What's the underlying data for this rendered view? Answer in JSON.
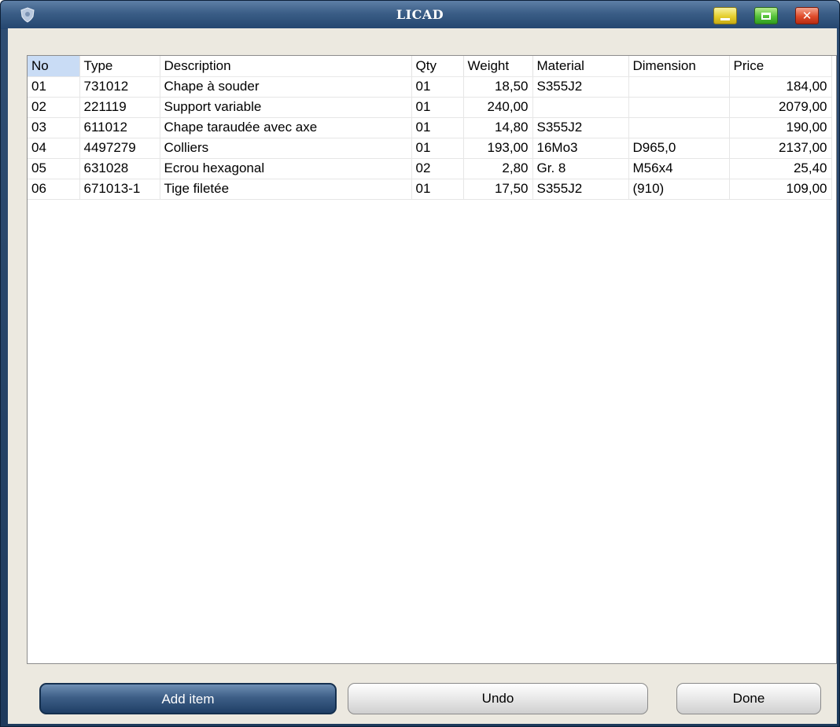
{
  "window": {
    "title": "LICAD",
    "app_icon": "shield-crest-icon"
  },
  "title_buttons": {
    "minimize": "minimize-icon",
    "maximize": "maximize-icon",
    "close": "close-icon",
    "close_glyph": "✕"
  },
  "columns": [
    "No",
    "Type",
    "Description",
    "Qty",
    "Weight",
    "Material",
    "Dimension",
    "Price"
  ],
  "rows": [
    [
      "01",
      "731012",
      "Chape à souder",
      "01",
      "18,50",
      "S355J2",
      "",
      "184,00"
    ],
    [
      "02",
      "221119",
      "Support variable",
      "01",
      "240,00",
      "",
      "",
      "2079,00"
    ],
    [
      "03",
      "611012",
      "Chape taraudée avec axe",
      "01",
      "14,80",
      "S355J2",
      "",
      "190,00"
    ],
    [
      "04",
      "4497279",
      "Colliers",
      "01",
      "193,00",
      "16Mo3",
      "D965,0",
      "2137,00"
    ],
    [
      "05",
      "631028",
      "Ecrou hexagonal",
      "02",
      "2,80",
      "Gr. 8",
      "M56x4",
      "25,40"
    ],
    [
      "06",
      "671013-1",
      "Tige filetée",
      "01",
      "17,50",
      "S355J2",
      "(910)",
      "109,00"
    ]
  ],
  "buttons": {
    "add": "Add item",
    "undo": "Undo",
    "done": "Done"
  }
}
